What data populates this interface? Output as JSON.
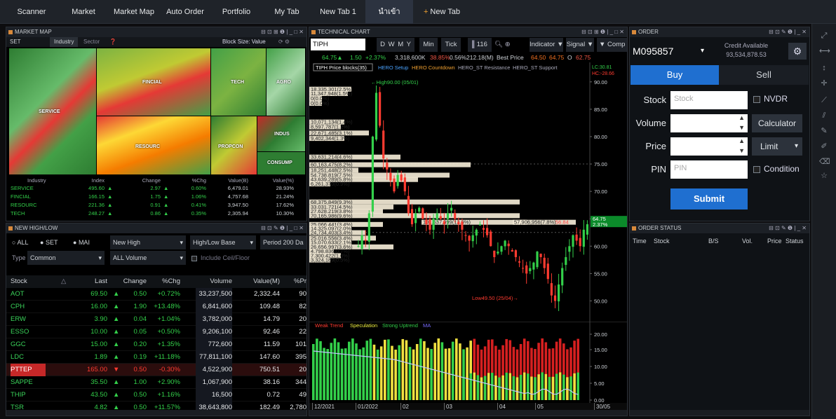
{
  "tabs": [
    "Scanner",
    "Market",
    "Market Map",
    "Auto Order",
    "Portfolio",
    "My Tab",
    "New Tab 1",
    "นำเข้า"
  ],
  "new_tab_label": "New Tab",
  "market_map": {
    "title": "MARKET MAP",
    "set_label": "SET",
    "industry_tab": "Industry",
    "sector_tab": "Sector",
    "block_size": "Block Size: Value",
    "tiles": [
      "SERVICE",
      "FINCIAL",
      "TECH",
      "AGRO",
      "RESOURC",
      "PROPCON",
      "INDUS",
      "CONSUMP"
    ],
    "headers": [
      "Industry",
      "Index",
      "Change",
      "%Chg",
      "Value(B)",
      "Value(%)"
    ],
    "rows": [
      [
        "SERVICE",
        "495.60",
        "2.97",
        "0.60%",
        "6,479.01",
        "28.93%"
      ],
      [
        "FINCIAL",
        "166.15",
        "1.75",
        "1.06%",
        "4,757.68",
        "21.24%"
      ],
      [
        "RESOURC",
        "221.36",
        "0.91",
        "0.41%",
        "3,947.50",
        "17.62%"
      ],
      [
        "TECH",
        "248.27",
        "0.86",
        "0.35%",
        "2,305.94",
        "10.30%"
      ]
    ]
  },
  "highlow": {
    "title": "NEW HIGH/LOW",
    "filters": [
      "ALL",
      "SET",
      "MAI"
    ],
    "new_high": "New High",
    "base": "High/Low Base",
    "period": "Period 200 Da",
    "type_label": "Type",
    "type_value": "Common",
    "volume": "ALL Volume",
    "ceil_floor": "Include Ceil/Floor",
    "headers": [
      "Stock",
      "Last",
      "Change",
      "%Chg",
      "Volume",
      "Value(M)",
      "%Pr"
    ],
    "rows": [
      [
        "AOT",
        "69.50",
        "0.50",
        "+0.72%",
        "33,237,500",
        "2,332.44",
        "90"
      ],
      [
        "CPH",
        "16.00",
        "1.90",
        "+13.48%",
        "6,841,600",
        "109.48",
        "82"
      ],
      [
        "ERW",
        "3.90",
        "0.04",
        "+1.04%",
        "3,782,000",
        "14.79",
        "20"
      ],
      [
        "ESSO",
        "10.00",
        "0.05",
        "+0.50%",
        "9,206,100",
        "92.46",
        "22"
      ],
      [
        "GGC",
        "15.00",
        "0.20",
        "+1.35%",
        "772,600",
        "11.59",
        "101"
      ],
      [
        "LDC",
        "1.89",
        "0.19",
        "+11.18%",
        "77,811,100",
        "147.60",
        "395"
      ],
      [
        "PTTEP",
        "165.00",
        "0.50",
        "-0.30%",
        "4,522,900",
        "750.51",
        "20"
      ],
      [
        "SAPPE",
        "35.50",
        "1.00",
        "+2.90%",
        "1,067,900",
        "38.16",
        "344"
      ],
      [
        "THIP",
        "43.50",
        "0.50",
        "+1.16%",
        "16,500",
        "0.72",
        "49"
      ],
      [
        "TSR",
        "4.82",
        "0.50",
        "+11.57%",
        "38,643,800",
        "182.49",
        "2,780"
      ]
    ]
  },
  "chart": {
    "title": "TECHNICAL CHART",
    "symbol": "TIPH",
    "periods": [
      "D",
      "W",
      "M",
      "Y"
    ],
    "min_label": "Min",
    "tick_label": "Tick",
    "tick_value": "116",
    "indicator": "Indicator ▼",
    "signal": "Signal ▼",
    "comp": "Comp",
    "quote": [
      "64.75▲",
      "1.50",
      "+2.37%",
      "3,318,600K",
      "38.85%",
      "0.56%",
      "212.18(M)",
      "Best Price",
      "64.50",
      "64.75",
      "O",
      "62.75"
    ],
    "legend": [
      "TIPH Price blocks(35)",
      "HERO Setup",
      "HERO Countdown",
      "HERO_ST Resistance",
      "HERO_ST Support"
    ],
    "lc": "LC:30.81",
    "hc": "HC:-28.66",
    "high_label": "High90.00 (05/01)",
    "low_label": "Low49.50 (25/04)",
    "y_ticks": [
      "90.00",
      "85.00",
      "80.00",
      "75.00",
      "70.00",
      "65.00",
      "60.00",
      "55.00",
      "50.00"
    ],
    "last_price": "64.75",
    "last_pct": "2.37%",
    "price_blocks": [
      "18,335,301(2.5%)",
      "11,347,948(1.5%)",
      "0(0.0%)",
      "0(0.0%)",
      "10,071,134(1.4%)",
      "8,597,787(1.2%)",
      "22,671,485(3.1%)",
      "9,402,344(1.3%)",
      "33,631,214(4.6%)",
      "60,163,475(8.2%)",
      "18,251,448(2.5%)",
      "54,738,819(7.5%)",
      "43,639,289(5.8%)",
      "6,261,370(0.9%)",
      "68,375,849(9.3%)",
      "33,031,721(4.5%)",
      "27,628,219(3.8%)",
      "70,165,986(9.6%)",
      "25,066,441(3.4%)",
      "14,325,097(2.0%)",
      "24,734,403(3.4%)",
      "25,016,556(3.4%)",
      "15,070,633(2.1%)",
      "26,656,997(3.6%)",
      "4,798,836(0.7%)",
      "7,300,422(1.0%)",
      "3,324,189(0.5%)",
      "101,537,899(13.8%)",
      "57,906,956(7.8%)",
      "56.84"
    ],
    "sub_legend": [
      "Weak Trend",
      "Speculation",
      "Strong Uptrend",
      "MA"
    ],
    "sub_ticks": [
      "20.00",
      "15.00",
      "10.00",
      "5.00",
      "0.00"
    ],
    "x_ticks": [
      "12/2021",
      "01/2022",
      "02",
      "03",
      "04",
      "05",
      "30/05"
    ]
  },
  "order": {
    "title": "ORDER",
    "account": "M095857",
    "credit_label": "Credit Available",
    "credit_value": "93,534,878.53",
    "buy": "Buy",
    "sell": "Sell",
    "stock_label": "Stock",
    "stock_ph": "Stock",
    "nvdr": "NVDR",
    "volume_label": "Volume",
    "calculator": "Calculator",
    "price_label": "Price",
    "limit": "Limit",
    "pin_label": "PIN",
    "pin_ph": "PIN",
    "condition": "Condition",
    "submit": "Submit"
  },
  "order_status": {
    "title": "ORDER STATUS",
    "headers": [
      "Time",
      "Stock",
      "B/S",
      "Vol.",
      "Price",
      "Status"
    ]
  },
  "colors": {
    "accent": "#1f6fd0",
    "up": "#33d04a",
    "down": "#ff3b30",
    "tab_orange": "#f0a030"
  }
}
